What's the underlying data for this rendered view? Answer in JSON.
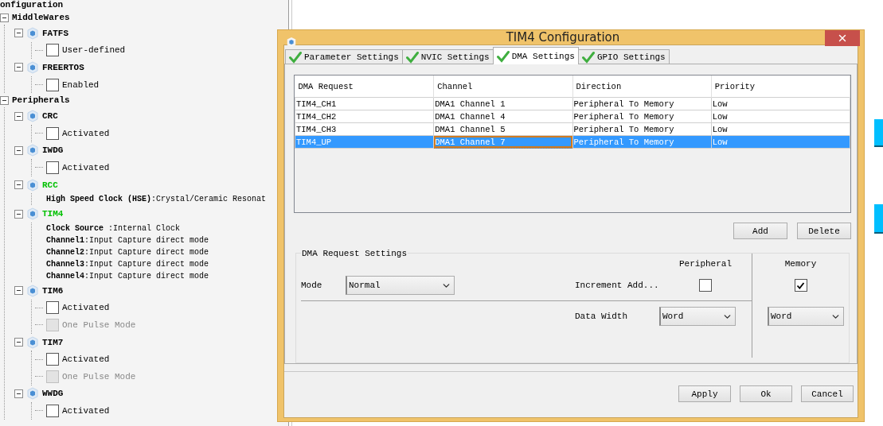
{
  "tree": {
    "title": "onfiguration",
    "groups": [
      {
        "label": "MiddleWares",
        "expanded": true,
        "children": [
          {
            "label": "FATFS",
            "color": "#000000",
            "expanded": true,
            "children": [
              {
                "kind": "checkbox",
                "label": "User-defined",
                "checked": false,
                "disabled": false
              }
            ]
          },
          {
            "label": "FREERTOS",
            "color": "#000000",
            "expanded": true,
            "children": [
              {
                "kind": "checkbox",
                "label": "Enabled",
                "checked": false,
                "disabled": false
              }
            ]
          }
        ]
      },
      {
        "label": "Peripherals",
        "expanded": true,
        "children": [
          {
            "label": "CRC",
            "color": "#000000",
            "expanded": true,
            "children": [
              {
                "kind": "checkbox",
                "label": "Activated",
                "checked": false,
                "disabled": false
              }
            ]
          },
          {
            "label": "IWDG",
            "color": "#000000",
            "expanded": true,
            "children": [
              {
                "kind": "checkbox",
                "label": "Activated",
                "checked": false,
                "disabled": false
              }
            ]
          },
          {
            "label": "RCC",
            "color": "#00c000",
            "expanded": true,
            "children": [
              {
                "kind": "setting",
                "text": "**High Speed Clock (HSE)**:Crystal/Ceramic Resonat"
              }
            ]
          },
          {
            "label": "TIM4",
            "color": "#00c000",
            "expanded": true,
            "children": [
              {
                "kind": "setting",
                "text": "**Clock Source** :Internal Clock"
              },
              {
                "kind": "setting",
                "text": "**Channel1**:Input Capture direct mode"
              },
              {
                "kind": "setting",
                "text": "**Channel2**:Input Capture direct mode"
              },
              {
                "kind": "setting",
                "text": "**Channel3**:Input Capture direct mode"
              },
              {
                "kind": "setting",
                "text": "**Channel4**:Input Capture direct mode"
              }
            ]
          },
          {
            "label": "TIM6",
            "color": "#000000",
            "expanded": true,
            "children": [
              {
                "kind": "checkbox",
                "label": "Activated",
                "checked": false,
                "disabled": false
              },
              {
                "kind": "checkbox",
                "label": "One Pulse Mode",
                "checked": false,
                "disabled": true
              }
            ]
          },
          {
            "label": "TIM7",
            "color": "#000000",
            "expanded": true,
            "children": [
              {
                "kind": "checkbox",
                "label": "Activated",
                "checked": false,
                "disabled": false
              },
              {
                "kind": "checkbox",
                "label": "One Pulse Mode",
                "checked": false,
                "disabled": true
              }
            ]
          },
          {
            "label": "WWDG",
            "color": "#000000",
            "expanded": true,
            "children": [
              {
                "kind": "checkbox",
                "label": "Activated",
                "checked": false,
                "disabled": false
              }
            ]
          }
        ]
      }
    ]
  },
  "dialog": {
    "title": "TIM4 Configuration",
    "tabs": [
      {
        "label": "Parameter Settings",
        "selected": false
      },
      {
        "label": "NVIC Settings",
        "selected": false
      },
      {
        "label": "DMA Settings",
        "selected": true
      },
      {
        "label": "GPIO Settings",
        "selected": false
      }
    ],
    "table": {
      "columns": [
        "DMA Request",
        "Channel",
        "Direction",
        "Priority"
      ],
      "rows": [
        {
          "selected": false,
          "cells": [
            {
              "text": "TIM4_CH1",
              "focused": false
            },
            {
              "text": "DMA1 Channel 1",
              "focused": false
            },
            {
              "text": "Peripheral To Memory",
              "focused": false
            },
            {
              "text": "Low",
              "focused": false
            }
          ]
        },
        {
          "selected": false,
          "cells": [
            {
              "text": "TIM4_CH2",
              "focused": false
            },
            {
              "text": "DMA1 Channel 4",
              "focused": false
            },
            {
              "text": "Peripheral To Memory",
              "focused": false
            },
            {
              "text": "Low",
              "focused": false
            }
          ]
        },
        {
          "selected": false,
          "cells": [
            {
              "text": "TIM4_CH3",
              "focused": false
            },
            {
              "text": "DMA1 Channel 5",
              "focused": false
            },
            {
              "text": "Peripheral To Memory",
              "focused": false
            },
            {
              "text": "Low",
              "focused": false
            }
          ]
        },
        {
          "selected": true,
          "cells": [
            {
              "text": "TIM4_UP",
              "focused": false
            },
            {
              "text": "DMA1 Channel 7",
              "focused": true
            },
            {
              "text": "Peripheral To Memory",
              "focused": false
            },
            {
              "text": "Low",
              "focused": false
            }
          ]
        }
      ]
    },
    "table_buttons": [
      "Add",
      "Delete"
    ],
    "request_settings": {
      "title": "DMA Request Settings",
      "mode_label": "Mode",
      "mode": "Normal",
      "peripheral_heading": "Peripheral",
      "memory_heading": "Memory",
      "increment_label": "Increment Add...",
      "peripheral_increment": false,
      "memory_increment": true,
      "data_width_label": "Data Width",
      "peripheral_width": "Word",
      "memory_width": "Word"
    },
    "buttons": [
      "Apply",
      "Ok",
      "Cancel"
    ]
  }
}
